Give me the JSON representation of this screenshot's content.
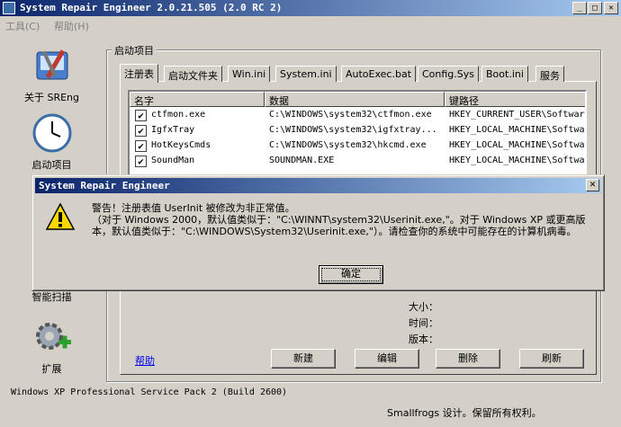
{
  "window": {
    "title": "System Repair Engineer 2.0.21.505 (2.0 RC 2)",
    "min": "_",
    "max": "□",
    "close": "✕"
  },
  "menu": [
    {
      "label": "工具(C)"
    },
    {
      "label": "帮助(H)"
    }
  ],
  "sidebar": [
    {
      "label": "关于 SREng",
      "icon": "toolbox-icon"
    },
    {
      "label": "启动项目",
      "icon": "clock-icon"
    },
    {
      "label": "智能扫描",
      "icon": "scan-icon"
    },
    {
      "label": "扩展",
      "icon": "gear-plus-icon"
    }
  ],
  "group": {
    "title": "启动项目"
  },
  "tabs": [
    "注册表",
    "启动文件夹",
    "Win.ini",
    "System.ini",
    "AutoExec.bat",
    "Config.Sys",
    "Boot.ini",
    "服务"
  ],
  "list": {
    "columns": [
      "名字",
      "数据",
      "键路径"
    ],
    "rows": [
      {
        "name": "ctfmon.exe",
        "data": "C:\\WINDOWS\\system32\\ctfmon.exe",
        "path": "HKEY_CURRENT_USER\\Softwar",
        "checked": "✔"
      },
      {
        "name": "IgfxTray",
        "data": "C:\\WINDOWS\\system32\\igfxtray...",
        "path": "HKEY_LOCAL_MACHINE\\Softwa",
        "checked": "✔"
      },
      {
        "name": "HotKeysCmds",
        "data": "C:\\WINDOWS\\system32\\hkcmd.exe",
        "path": "HKEY_LOCAL_MACHINE\\Softwa",
        "checked": "✔"
      },
      {
        "name": "SoundMan",
        "data": "SOUNDMAN.EXE",
        "path": "HKEY_LOCAL_MACHINE\\Softwa",
        "checked": "✔"
      }
    ]
  },
  "details": {
    "size": "大小：",
    "time": "时间：",
    "version": "版本："
  },
  "help": "帮助",
  "buttons": {
    "new": "新建",
    "edit": "编辑",
    "delete": "删除",
    "refresh": "刷新"
  },
  "status": {
    "os": "Windows XP Professional Service Pack 2 (Build 2600)",
    "credit": "Smallfrogs 设计。保留所有权利。"
  },
  "dialog": {
    "title": "System Repair Engineer",
    "close": "✕",
    "line1": "警告！注册表值 UserInit 被修改为非正常值。",
    "line2": "（对于 Windows 2000，默认值类似于：\"C:\\WINNT\\system32\\Userinit.exe,\"。对于 Windows XP 或更高版本，默认值类似于：\"C:\\WINDOWS\\System32\\Userinit.exe,\"）。请检查你的系统中可能存在的计算机病毒。",
    "ok": "确定"
  },
  "colors": {
    "title_start": "#0a246a",
    "title_end": "#a6caf0",
    "face": "#d4d0c8"
  }
}
